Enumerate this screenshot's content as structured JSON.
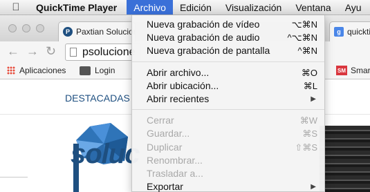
{
  "menubar": {
    "app_name": "QuickTime Player",
    "items": [
      "Archivo",
      "Edición",
      "Visualización",
      "Ventana",
      "Ayu"
    ]
  },
  "browser": {
    "tabs": [
      {
        "favicon": "P",
        "title": "Paxtian Solucion"
      },
      {
        "favicon": "g",
        "title": "quickti"
      }
    ],
    "address": "psolucione",
    "bookmarks": [
      {
        "icon": "apps-grid-icon",
        "label": "Aplicaciones"
      },
      {
        "icon": "login-icon",
        "label": "Login"
      },
      {
        "icon": "sm-icon",
        "icon_text": "SM",
        "label": "Smart"
      }
    ]
  },
  "page": {
    "nav": "DESTACADAS",
    "logo_text": "soluc"
  },
  "dropdown": {
    "groups": [
      [
        {
          "label": "Nueva grabación de vídeo",
          "shortcut": "⌥⌘N",
          "enabled": true
        },
        {
          "label": "Nueva grabación de audio",
          "shortcut": "^⌥⌘N",
          "enabled": true
        },
        {
          "label": "Nueva grabación de pantalla",
          "shortcut": "^⌘N",
          "enabled": true
        }
      ],
      [
        {
          "label": "Abrir archivo...",
          "shortcut": "⌘O",
          "enabled": true
        },
        {
          "label": "Abrir ubicación...",
          "shortcut": "⌘L",
          "enabled": true
        },
        {
          "label": "Abrir recientes",
          "submenu": true,
          "enabled": true
        }
      ],
      [
        {
          "label": "Cerrar",
          "shortcut": "⌘W",
          "enabled": false
        },
        {
          "label": "Guardar...",
          "shortcut": "⌘S",
          "enabled": false
        },
        {
          "label": "Duplicar",
          "shortcut": "⇧⌘S",
          "enabled": false
        },
        {
          "label": "Renombrar...",
          "enabled": false
        },
        {
          "label": "Trasladar a...",
          "enabled": false
        },
        {
          "label": "Exportar",
          "submenu": true,
          "enabled": true
        }
      ]
    ],
    "submenu_arrow": "▶"
  }
}
